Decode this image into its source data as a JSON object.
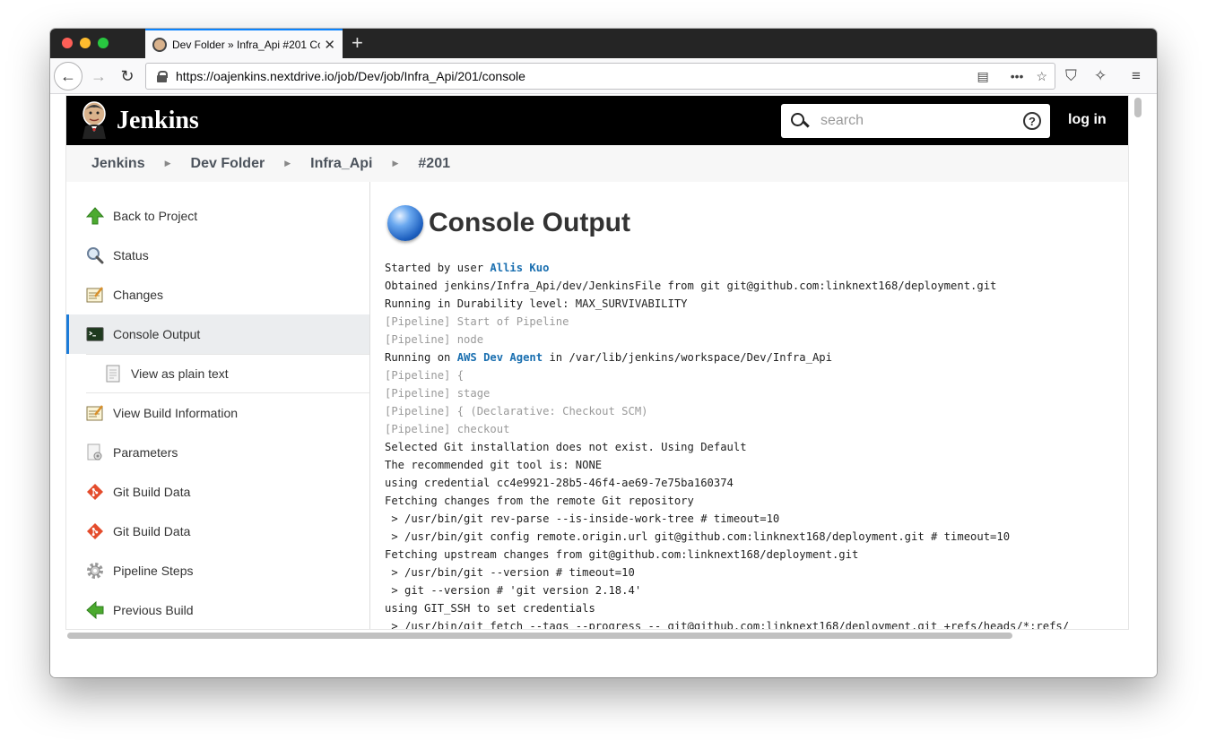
{
  "browser": {
    "tab_title": "Dev Folder » Infra_Api #201 Co",
    "url": "https://oajenkins.nextdrive.io/job/Dev/job/Infra_Api/201/console"
  },
  "header": {
    "title": "Jenkins",
    "search_placeholder": "search",
    "help": "?",
    "login": "log in"
  },
  "breadcrumbs": [
    "Jenkins",
    "Dev Folder",
    "Infra_Api",
    "#201"
  ],
  "sidebar": {
    "items": [
      {
        "label": "Back to Project",
        "icon": "up-arrow-icon"
      },
      {
        "label": "Status",
        "icon": "magnifier-icon"
      },
      {
        "label": "Changes",
        "icon": "notepad-icon"
      },
      {
        "label": "Console Output",
        "icon": "terminal-icon",
        "active": true
      },
      {
        "label": "View as plain text",
        "icon": "document-icon",
        "sub": true
      },
      {
        "label": "View Build Information",
        "icon": "notepad-icon"
      },
      {
        "label": "Parameters",
        "icon": "document-gear-icon"
      },
      {
        "label": "Git Build Data",
        "icon": "git-icon"
      },
      {
        "label": "Git Build Data",
        "icon": "git-icon"
      },
      {
        "label": "Pipeline Steps",
        "icon": "gear-icon"
      },
      {
        "label": "Previous Build",
        "icon": "left-arrow-icon"
      }
    ]
  },
  "main": {
    "title": "Console Output",
    "console": {
      "l1_pre": "Started by user ",
      "l1_link": "Allis Kuo",
      "l2": "Obtained jenkins/Infra_Api/dev/JenkinsFile from git git@github.com:linknext168/deployment.git",
      "l3": "Running in Durability level: MAX_SURVIVABILITY",
      "l4": "[Pipeline] Start of Pipeline",
      "l5": "[Pipeline] node",
      "l6_pre": "Running on ",
      "l6_link": "AWS Dev Agent",
      "l6_post": " in /var/lib/jenkins/workspace/Dev/Infra_Api",
      "l7": "[Pipeline] {",
      "l8": "[Pipeline] stage",
      "l9": "[Pipeline] { (Declarative: Checkout SCM)",
      "l10": "[Pipeline] checkout",
      "l11": "Selected Git installation does not exist. Using Default",
      "l12": "The recommended git tool is: NONE",
      "l13": "using credential cc4e9921-28b5-46f4-ae69-7e75ba160374",
      "l14": "Fetching changes from the remote Git repository",
      "l15": " > /usr/bin/git rev-parse --is-inside-work-tree # timeout=10",
      "l16": " > /usr/bin/git config remote.origin.url git@github.com:linknext168/deployment.git # timeout=10",
      "l17": "Fetching upstream changes from git@github.com:linknext168/deployment.git",
      "l18": " > /usr/bin/git --version # timeout=10",
      "l19": " > git --version # 'git version 2.18.4'",
      "l20": "using GIT_SSH to set credentials",
      "l21": " > /usr/bin/git fetch --tags --progress -- git@github.com:linknext168/deployment.git +refs/heads/*:refs/"
    }
  },
  "colors": {
    "header_bg": "#000000",
    "link": "#1a6fb0",
    "active_border": "#1b7bd8",
    "pipeline_text": "#9a9a9a"
  }
}
